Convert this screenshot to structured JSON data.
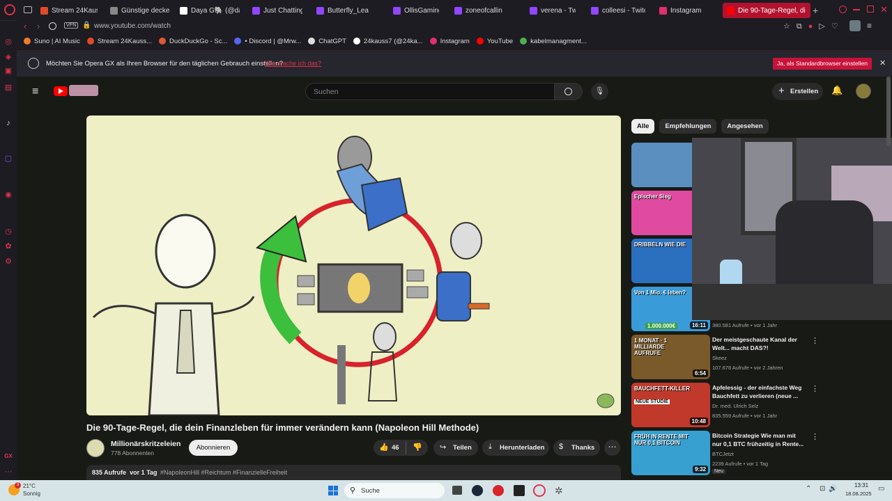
{
  "tabs": [
    {
      "label": "Stream 24Kauss",
      "color": "#e04a2a"
    },
    {
      "label": "Günstige decken",
      "color": "#888888"
    },
    {
      "label": "Daya G🐘 (@day",
      "color": "#ffffff"
    },
    {
      "label": "Just Chatting - T",
      "color": "#9146ff"
    },
    {
      "label": "Butterfly_Lea",
      "color": "#9146ff"
    },
    {
      "label": "OllisGamingW",
      "color": "#9146ff"
    },
    {
      "label": "zoneofcallin",
      "color": "#9146ff"
    },
    {
      "label": "verena - Twitc",
      "color": "#9146ff"
    },
    {
      "label": "colleesi - Twitch",
      "color": "#9146ff"
    },
    {
      "label": "Instagram",
      "color": "#e1306c"
    },
    {
      "label": "Die 90-Tage-Regel, di",
      "color": "#ff0000"
    }
  ],
  "address": {
    "url": "www.youtube.com/watch",
    "vpn": "VPN"
  },
  "bookmarks": [
    {
      "label": "Suno | AI Music",
      "color": "#f07c2a"
    },
    {
      "label": "Stream 24Kauss...",
      "color": "#e04a2a"
    },
    {
      "label": "DuckDuckGo - Sc...",
      "color": "#de5833"
    },
    {
      "label": "• Discord | @Mrw...",
      "color": "#5865f2"
    },
    {
      "label": "ChatGPT",
      "color": "#dddddd"
    },
    {
      "label": "24kauss7 (@24ka...",
      "color": "#ffffff"
    },
    {
      "label": "Instagram",
      "color": "#e1306c"
    },
    {
      "label": "YouTube",
      "color": "#ff0000"
    },
    {
      "label": "kabelmanagment...",
      "color": "#4caf50"
    }
  ],
  "banner": {
    "text": "Möchten Sie Opera GX als Ihren Browser für den täglichen Gebrauch einstellen?",
    "link": "Wie mache ich das?",
    "button": "Ja, als Standardbrowser einstellen",
    "close": "✕"
  },
  "youtube": {
    "search_placeholder": "Suchen",
    "create_label": "Erstellen",
    "chips": [
      "Alle",
      "Empfehlungen",
      "Angesehen"
    ],
    "video_title": "Die 90-Tage-Regel, die dein Finanzleben für immer verändern kann (Napoleon Hill Methode)",
    "channel": "Millionärskritzeleien",
    "subscribers": "778 Abonnenten",
    "subscribe_label": "Abonnieren",
    "likes": "46",
    "share_label": "Teilen",
    "download_label": "Herunterladen",
    "thanks_label": "Thanks",
    "desc_stats": "835 Aufrufe  vor 1 Tag",
    "desc_tags": "#NapoleonHill #Reichtum #FinanzielleFreiheit"
  },
  "sidebar_videos": [
    {
      "thumb_text": "",
      "color": "#5a8fc0"
    },
    {
      "thumb_text": "Epischer Sieg",
      "color": "#e04aa0"
    },
    {
      "thumb_text": "DRIBBELN WIE DIE",
      "color": "#2b6fbf"
    },
    {
      "thumb_text": "Von 1 Mio. € leben?",
      "duration": "16:11",
      "badge": "1.000.000€",
      "color": "#3a9bd9",
      "views": "380.581 Aufrufe • vor 1 Jahr"
    },
    {
      "title": "Der meistgeschaute Kanal der Welt... macht DAS?!",
      "channel": "Skeez",
      "meta": "107.678 Aufrufe • vor 2 Jahren",
      "duration": "6:54",
      "thumb_text": "1 MONAT · 1 MILLIARDE AUFRUFE",
      "color": "#7a5a2a"
    },
    {
      "title": "Apfelessig - der einfachste Weg Bauchfett zu verlieren (neue ...",
      "channel": "Dr. med. Ulrich Selz",
      "meta": "835.559 Aufrufe • vor 1 Jahr",
      "duration": "10:48",
      "thumb_text": "BAUCHFETT-KILLER",
      "thumb_sub": "NEUE STUDIE",
      "color": "#c0392b"
    },
    {
      "title": "Bitcoin Strategie Wie man mit nur 0,1 BTC frühzeitig in Rente...",
      "channel": "BTCJetzt",
      "meta": "2239 Aufrufe • vor 1 Tag",
      "duration": "9:32",
      "badge": "Neu",
      "thumb_text": "FRÜH IN RENTE MIT NUR 0,1 BITCOIN",
      "color": "#37a0d0"
    }
  ],
  "taskbar": {
    "weather_temp": "21°C",
    "weather_desc": "Sonnig",
    "weather_badge": "3",
    "search_label": "Suche",
    "time": "13:31",
    "date": "18.08.2025"
  }
}
